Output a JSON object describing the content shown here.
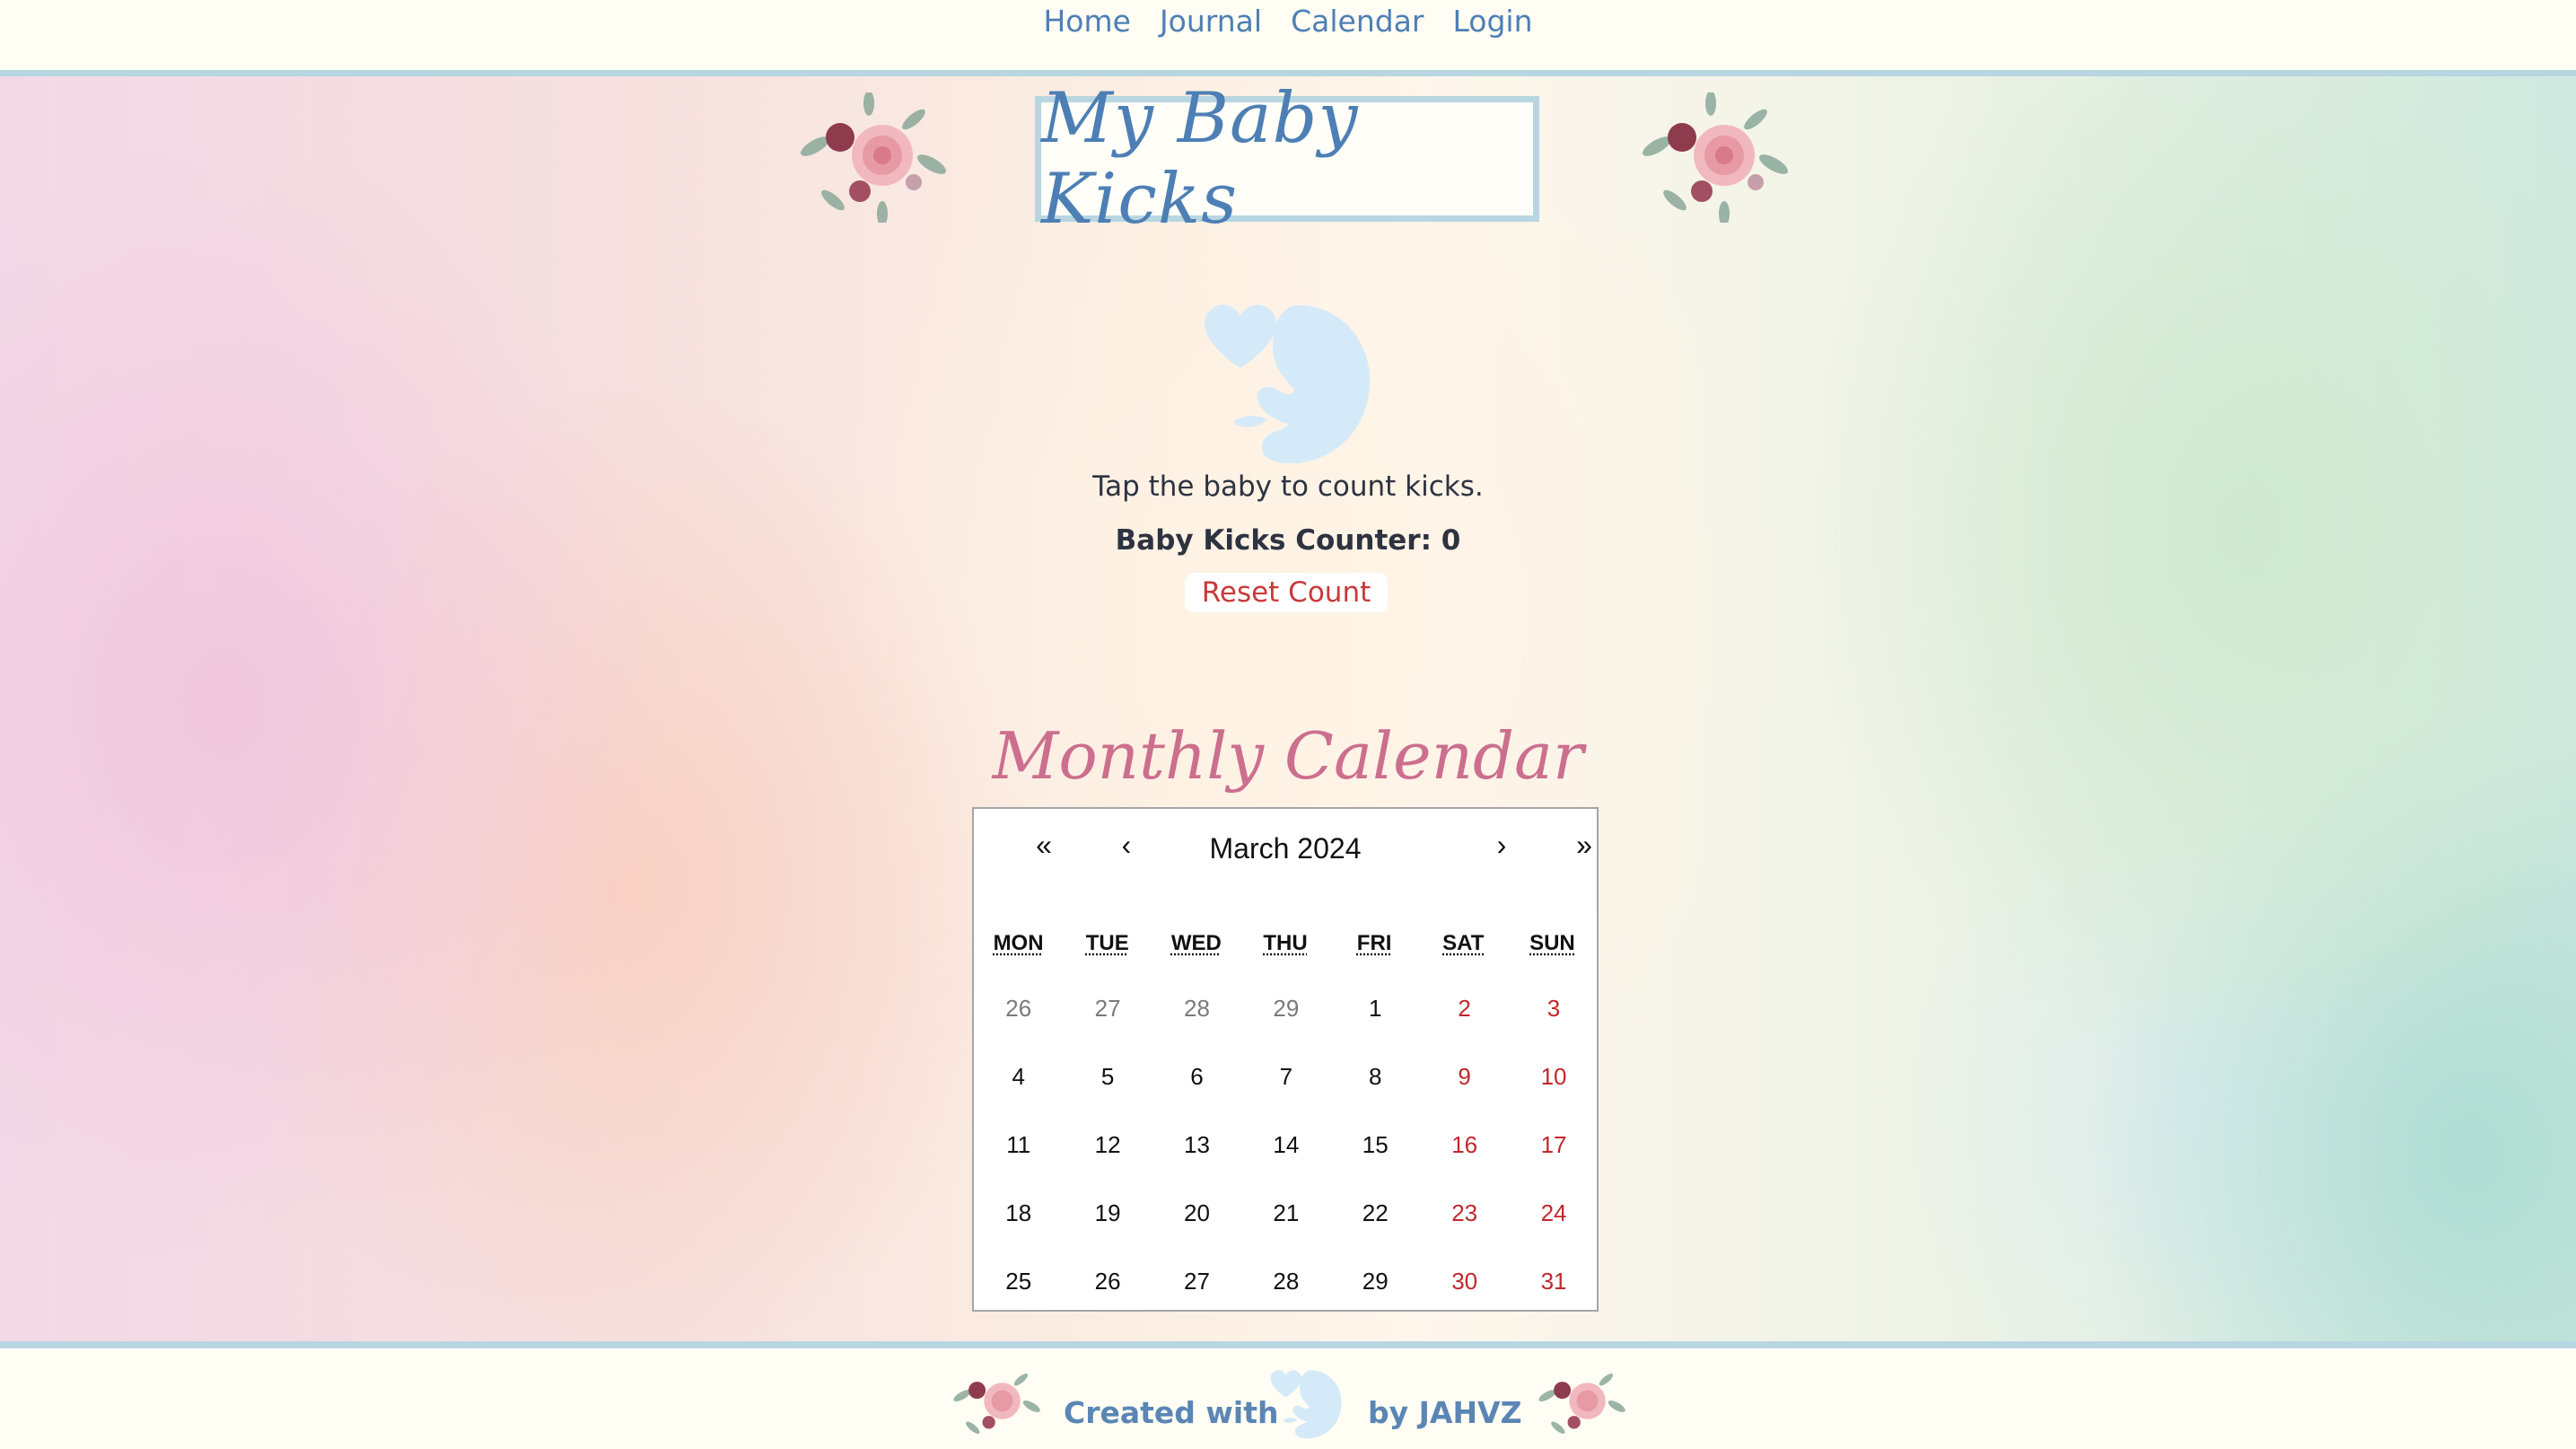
{
  "nav": {
    "items": [
      {
        "label": "Home"
      },
      {
        "label": "Journal"
      },
      {
        "label": "Calendar"
      },
      {
        "label": "Login"
      }
    ]
  },
  "header": {
    "title": "My Baby Kicks"
  },
  "counter": {
    "hint": "Tap the baby to count kicks.",
    "label": "Baby Kicks Counter: 0",
    "reset_label": "Reset Count"
  },
  "calendar": {
    "title": "Monthly Calendar",
    "month_label": "March 2024",
    "nav": {
      "prev_year": "«",
      "prev_month": "‹",
      "next_month": "›",
      "next_year": "»"
    },
    "weekdays": [
      "MON",
      "TUE",
      "WED",
      "THU",
      "FRI",
      "SAT",
      "SUN"
    ],
    "weeks": [
      [
        "26",
        "27",
        "28",
        "29",
        "1",
        "2",
        "3"
      ],
      [
        "4",
        "5",
        "6",
        "7",
        "8",
        "9",
        "10"
      ],
      [
        "11",
        "12",
        "13",
        "14",
        "15",
        "16",
        "17"
      ],
      [
        "18",
        "19",
        "20",
        "21",
        "22",
        "23",
        "24"
      ],
      [
        "25",
        "26",
        "27",
        "28",
        "29",
        "30",
        "31"
      ]
    ],
    "colors": {
      "weekend": "#c0282c",
      "other_month": "#7a7a7a"
    }
  },
  "footer": {
    "created_with": "Created with",
    "by": "by JAHVZ"
  },
  "colors": {
    "accent": "#4d7fb5",
    "border": "#b7d6e2",
    "pink_title": "#cc6f8e",
    "reset_red": "#c93a3a"
  }
}
